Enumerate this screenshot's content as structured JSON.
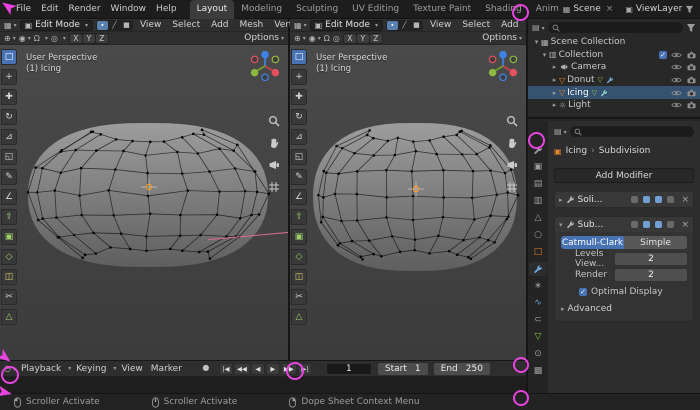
{
  "colors": {
    "accent_blue": "#4772b3",
    "annotation_pink": "#e743df",
    "object_orange": "#e8811c",
    "selected_row_blue": "#355271"
  },
  "topbar": {
    "menus": [
      "File",
      "Edit",
      "Render",
      "Window",
      "Help"
    ],
    "workspaces": [
      "Layout",
      "Modeling",
      "Sculpting",
      "UV Editing",
      "Texture Paint",
      "Shading",
      "Anim"
    ],
    "active_workspace": "Layout",
    "scene_label": "Scene",
    "viewlayer_label": "ViewLayer"
  },
  "viewport_left": {
    "mode_label": "Edit Mode",
    "menus": [
      "View",
      "Select",
      "Add",
      "Mesh",
      "Vertex"
    ],
    "mirror_axes": [
      "X",
      "Y",
      "Z"
    ],
    "options_label": "Options",
    "overlay_perspective": "User Perspective",
    "overlay_object": "(1) Icing"
  },
  "viewport_right": {
    "mode_label": "Edit Mode",
    "menus": [
      "View",
      "Select",
      "Add"
    ],
    "mirror_axes": [
      "X",
      "Y",
      "Z"
    ],
    "options_label": "Options",
    "overlay_perspective": "User Perspective",
    "overlay_object": "(1) Icing"
  },
  "toolbar_tools": [
    "select-box",
    "cursor",
    "move",
    "rotate",
    "scale",
    "transform",
    "annotate",
    "measure",
    "extrude-region",
    "inset-faces",
    "bevel",
    "loop-cut",
    "knife",
    "poly-build"
  ],
  "outliner": {
    "rows": [
      {
        "label": "Scene Collection"
      },
      {
        "label": "Collection"
      },
      {
        "label": "Camera"
      },
      {
        "label": "Donut"
      },
      {
        "label": "Icing",
        "selected": true
      },
      {
        "label": "Light"
      }
    ]
  },
  "properties": {
    "tabs": [
      "tool",
      "render",
      "output",
      "view-layer",
      "scene",
      "world",
      "object",
      "modifiers",
      "particles",
      "physics",
      "constraints",
      "object-data",
      "material",
      "texture"
    ],
    "active_tab": "modifiers",
    "breadcrumb_object": "Icing",
    "breadcrumb_item": "Subdivision",
    "add_modifier_label": "Add Modifier",
    "modifiers": [
      {
        "name": "Soli..."
      },
      {
        "name": "Sub..."
      }
    ],
    "subdivision": {
      "algorithm_options": [
        "Catmull-Clark",
        "Simple"
      ],
      "algorithm_active": "Catmull-Clark",
      "levels_label": "Levels View...",
      "levels_value": "2",
      "render_label": "Render",
      "render_value": "2",
      "optimal_display_label": "Optimal Display",
      "optimal_display_checked": true,
      "advanced_label": "Advanced"
    }
  },
  "timeline": {
    "menus": [
      "Playback",
      "Keying",
      "View",
      "Marker"
    ],
    "current_frame": "1",
    "start_label": "Start",
    "start_value": "1",
    "end_label": "End",
    "end_value": "250"
  },
  "statusbar": {
    "items": [
      "Scroller Activate",
      "Scroller Activate",
      "Dope Sheet Context Menu"
    ]
  }
}
